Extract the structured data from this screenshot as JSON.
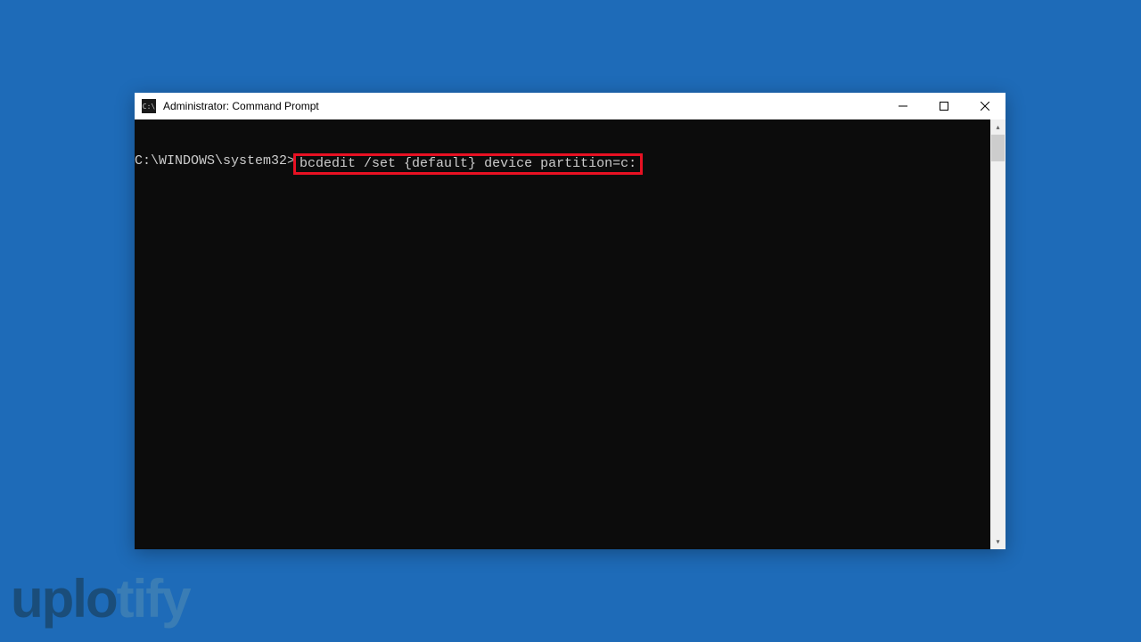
{
  "window": {
    "title": "Administrator: Command Prompt",
    "icon_label": "C:\\"
  },
  "terminal": {
    "prompt": "C:\\WINDOWS\\system32>",
    "command": "bcdedit /set {default} device partition=c:"
  },
  "watermark": {
    "part1": "uplo",
    "part2": "tify"
  }
}
